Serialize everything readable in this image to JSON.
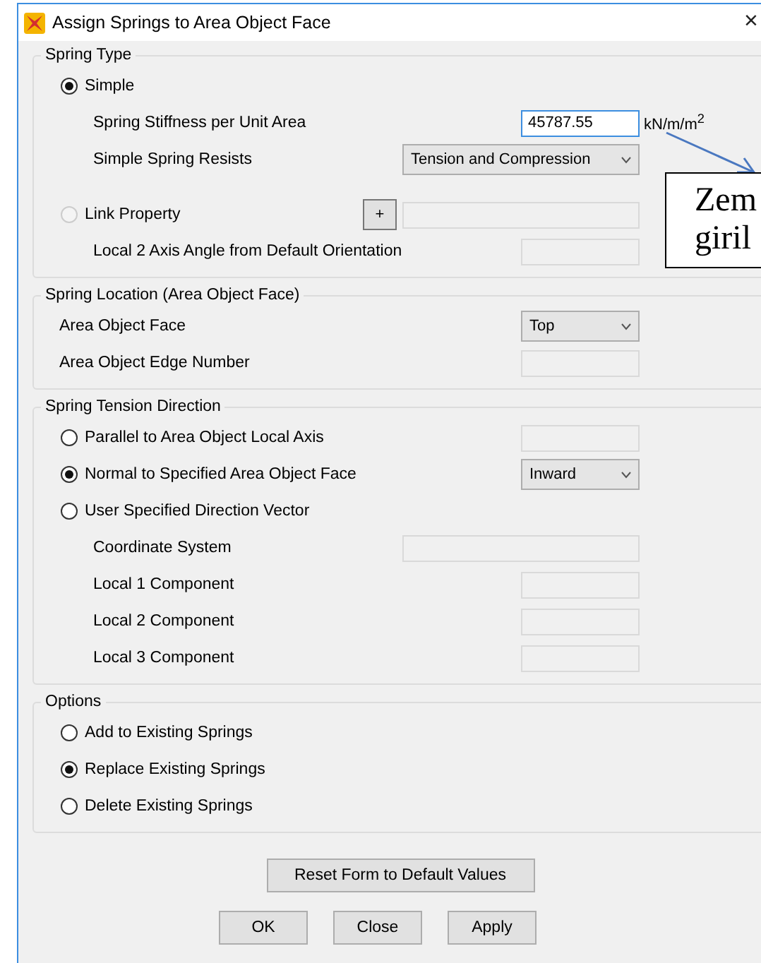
{
  "window": {
    "title": "Assign Springs to Area Object Face",
    "close": "×"
  },
  "groups": [
    {
      "title": "Spring Type",
      "rows": [
        {
          "kind": "radio",
          "label": "Simple",
          "selected": true,
          "disabled": false,
          "children": [
            {
              "kind": "field",
              "label": "Spring Stiffness per Unit Area",
              "control": {
                "kind": "input",
                "value": "45787.55",
                "focused": true
              },
              "unit": "kN/m/m$^{2}$"
            },
            {
              "kind": "field",
              "label": "Simple Spring Resists",
              "control": {
                "kind": "wide_select",
                "value": "Tension and Compression"
              }
            }
          ]
        },
        {
          "kind": "radio",
          "label": "Link Property",
          "selected": false,
          "disabled": true,
          "control": {
            "kind": "picker",
            "button": "+"
          },
          "children": [
            {
              "kind": "field",
              "label": "Local 2 Axis Angle from Default Orientation",
              "control": {
                "kind": "input"
              }
            }
          ]
        }
      ]
    },
    {
      "title": "Spring Location (Area Object Face)",
      "rows": [
        {
          "kind": "field",
          "label": "Area Object Face",
          "control": {
            "kind": "select",
            "value": "Top"
          }
        },
        {
          "kind": "field",
          "label": "Area Object Edge Number",
          "control": {
            "kind": "input"
          }
        }
      ]
    },
    {
      "title": "Spring Tension Direction",
      "rows": [
        {
          "kind": "radio",
          "label": "Parallel to Area Object Local Axis",
          "selected": false,
          "disabled": false,
          "control": {
            "kind": "input"
          }
        },
        {
          "kind": "radio",
          "label": "Normal to Specified Area Object Face",
          "selected": true,
          "disabled": false,
          "control": {
            "kind": "select",
            "value": "Inward"
          }
        },
        {
          "kind": "radio",
          "label": "User Specified Direction Vector",
          "selected": false,
          "disabled": false,
          "children": [
            {
              "kind": "field",
              "label": "Coordinate System",
              "control": {
                "kind": "wide_input"
              }
            },
            {
              "kind": "field",
              "label": "Local 1 Component",
              "control": {
                "kind": "input"
              }
            },
            {
              "kind": "field",
              "label": "Local 2 Component",
              "control": {
                "kind": "input"
              }
            },
            {
              "kind": "field",
              "label": "Local 3 Component",
              "control": {
                "kind": "input"
              }
            }
          ]
        }
      ]
    },
    {
      "title": "Options",
      "rows": [
        {
          "kind": "radio",
          "label": "Add to Existing Springs",
          "selected": false,
          "disabled": false
        },
        {
          "kind": "radio",
          "label": "Replace Existing Springs",
          "selected": true,
          "disabled": false
        },
        {
          "kind": "radio",
          "label": "Delete Existing Springs",
          "selected": false,
          "disabled": false
        }
      ]
    }
  ],
  "reset_button": "Reset Form to Default Values",
  "buttons": [
    "OK",
    "Close",
    "Apply"
  ],
  "callout": {
    "lines": [
      "Zem",
      "giril"
    ]
  }
}
